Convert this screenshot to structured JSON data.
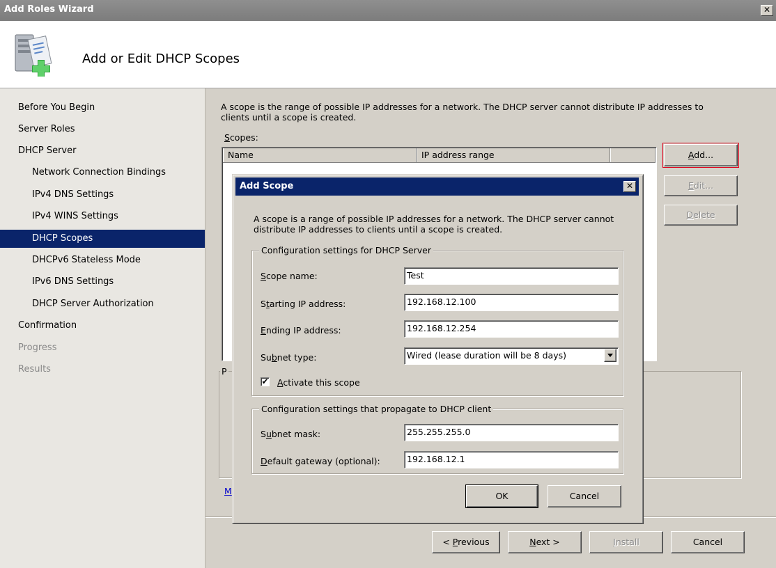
{
  "window": {
    "title": "Add Roles Wizard",
    "close_glyph": "✕",
    "page_heading": "Add or Edit DHCP Scopes",
    "header_icon": "server-add-icon"
  },
  "nav": {
    "items": [
      {
        "label": "Before You Begin",
        "level": 1,
        "state": "normal"
      },
      {
        "label": "Server Roles",
        "level": 1,
        "state": "normal"
      },
      {
        "label": "DHCP Server",
        "level": 1,
        "state": "normal"
      },
      {
        "label": "Network Connection Bindings",
        "level": 2,
        "state": "normal"
      },
      {
        "label": "IPv4 DNS Settings",
        "level": 2,
        "state": "normal"
      },
      {
        "label": "IPv4 WINS Settings",
        "level": 2,
        "state": "normal"
      },
      {
        "label": "DHCP Scopes",
        "level": 2,
        "state": "selected"
      },
      {
        "label": "DHCPv6 Stateless Mode",
        "level": 2,
        "state": "normal"
      },
      {
        "label": "IPv6 DNS Settings",
        "level": 2,
        "state": "normal"
      },
      {
        "label": "DHCP Server Authorization",
        "level": 2,
        "state": "normal"
      },
      {
        "label": "Confirmation",
        "level": 1,
        "state": "normal"
      },
      {
        "label": "Progress",
        "level": 1,
        "state": "disabled"
      },
      {
        "label": "Results",
        "level": 1,
        "state": "disabled"
      }
    ]
  },
  "main": {
    "description": "A scope is the range of possible IP addresses for a network. The DHCP server cannot distribute IP addresses to clients until a scope is created.",
    "scopes_label": "Scopes:",
    "columns": [
      "Name",
      "IP address range",
      ""
    ],
    "add_button": "Add...",
    "edit_button": "Edit...",
    "delete_button": "Delete",
    "group_label_fragment": "P",
    "more_link_fragment": "M"
  },
  "dialog": {
    "title": "Add Scope",
    "close_glyph": "✕",
    "description": "A scope is a range of possible IP addresses for a network. The DHCP server cannot distribute IP addresses to clients until a scope is created.",
    "server_group": {
      "legend": "Configuration settings for DHCP Server",
      "scope_name_label": "Scope name:",
      "scope_name_value": "Test",
      "start_ip_label": "Starting IP address:",
      "start_ip_value": "192.168.12.100",
      "end_ip_label": "Ending IP address:",
      "end_ip_value": "192.168.12.254",
      "subnet_type_label": "Subnet type:",
      "subnet_type_value": "Wired (lease duration will be 8 days)",
      "activate_label": "Activate this scope",
      "activate_checked": true,
      "check_glyph": "✔"
    },
    "client_group": {
      "legend": "Configuration settings that propagate to DHCP client",
      "subnet_mask_label": "Subnet mask:",
      "subnet_mask_value": "255.255.255.0",
      "gateway_label": "Default gateway (optional):",
      "gateway_value": "192.168.12.1"
    },
    "ok_button": "OK",
    "cancel_button": "Cancel"
  },
  "footer": {
    "previous_button": "< Previous",
    "next_button": "Next >",
    "install_button": "Install",
    "cancel_button": "Cancel"
  }
}
